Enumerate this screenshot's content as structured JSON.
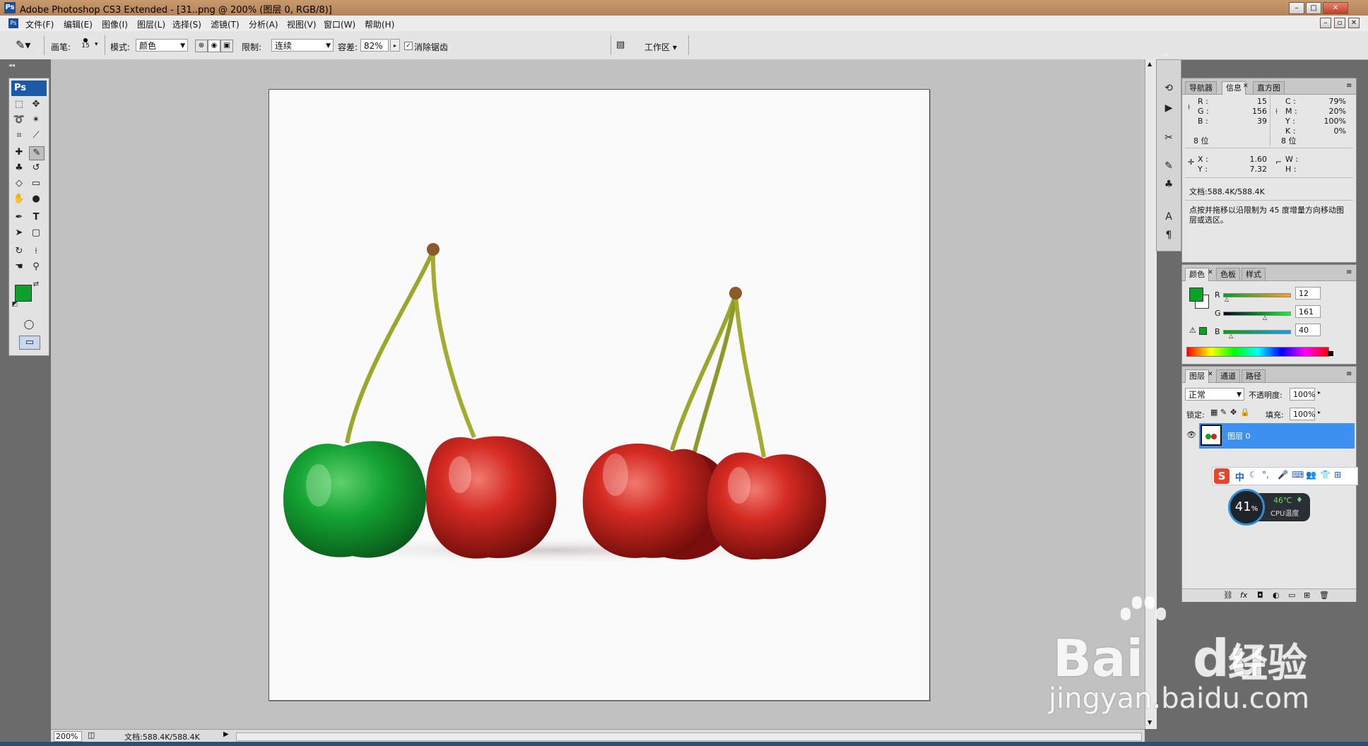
{
  "window": {
    "title": "Adobe Photoshop CS3 Extended - [31..png @ 200% (图层 0, RGB/8)]",
    "logo": "Ps"
  },
  "menu": [
    "文件(F)",
    "编辑(E)",
    "图像(I)",
    "图层(L)",
    "选择(S)",
    "滤镜(T)",
    "分析(A)",
    "视图(V)",
    "窗口(W)",
    "帮助(H)"
  ],
  "options": {
    "brush_label": "画笔:",
    "brush_size": "15",
    "mode_label": "模式:",
    "mode_value": "颜色",
    "limit_label": "限制:",
    "limit_value": "连续",
    "tolerance_label": "容差:",
    "tolerance_value": "82%",
    "antialias_label": "消除锯齿",
    "workspace_label": "工作区 ▾"
  },
  "toolbox": {
    "logo": "Ps"
  },
  "status": {
    "zoom": "200%",
    "doc": "文档:588.4K/588.4K"
  },
  "info_panel": {
    "tabs": [
      "导航器",
      "信息",
      "直方图"
    ],
    "rgb": {
      "r_label": "R :",
      "g_label": "G :",
      "b_label": "B :",
      "r": "15",
      "g": "156",
      "b": "39"
    },
    "cmyk": {
      "c_label": "C :",
      "m_label": "M :",
      "y_label": "Y :",
      "k_label": "K :",
      "c": "79%",
      "m": "20%",
      "y": "100%",
      "k": "0%"
    },
    "bits_left": "8 位",
    "bits_right": "8 位",
    "xy": {
      "x_label": "X :",
      "y_label": "Y :",
      "x": "1.60",
      "y": "7.32"
    },
    "wh": {
      "w_label": "W :",
      "h_label": "H :"
    },
    "doc": "文档:588.4K/588.4K",
    "hint": "点按并拖移以沿限制为 45 度增量方向移动图层或选区。"
  },
  "color_panel": {
    "tabs": [
      "颜色",
      "色板",
      "样式"
    ],
    "r_label": "R",
    "g_label": "G",
    "b_label": "B",
    "r": "12",
    "g": "161",
    "b": "40",
    "fg_color": "#0ca128",
    "bg_color": "#ffffff"
  },
  "layers_panel": {
    "tabs": [
      "图层",
      "通道",
      "路径"
    ],
    "blend": "正常",
    "opacity_label": "不透明度:",
    "opacity": "100%",
    "lock_label": "锁定:",
    "fill_label": "填充:",
    "fill": "100%",
    "layer_name": "图层 0"
  },
  "ime": {
    "label": "中"
  },
  "cpu": {
    "percent": "41",
    "unit": "%",
    "temp": "46℃",
    "label": "CPU温度"
  },
  "watermark": {
    "brand": "Bai",
    "brand2": "du",
    "cn": "经验",
    "url": "jingyan.baidu.com"
  }
}
